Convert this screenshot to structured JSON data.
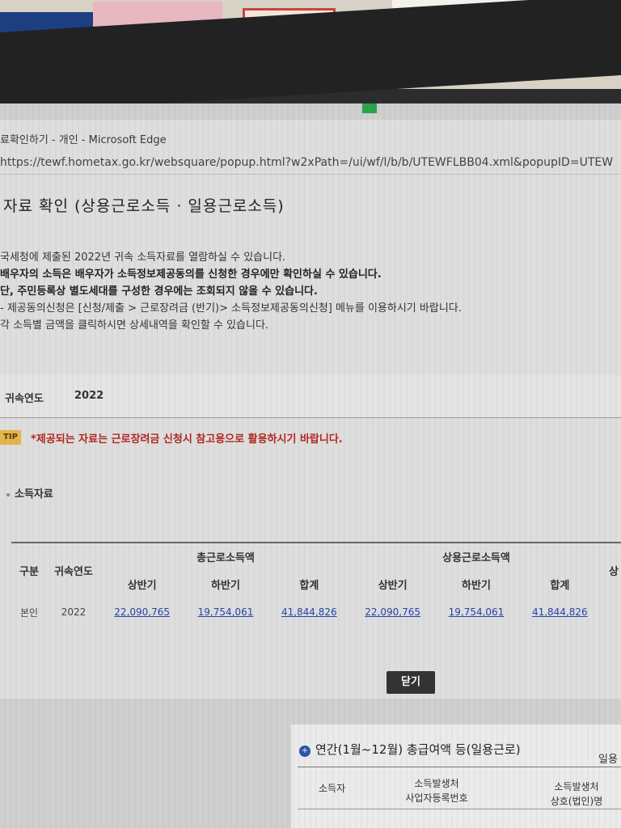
{
  "browser": {
    "window_title": "료확인하기 - 개인 - Microsoft Edge",
    "url": "https://tewf.hometax.go.kr/websquare/popup.html?w2xPath=/ui/wf/l/b/b/UTEWFLBB04.xml&popupID=UTEW"
  },
  "page": {
    "title": "자료 확인 (상용근로소득 · 일용근로소득)",
    "notes": [
      "국세청에 제출된 2022년 귀속 소득자료를 열람하실 수 있습니다.",
      "배우자의 소득은 배우자가 소득정보제공동의를 신청한 경우에만 확인하실 수 있습니다.",
      "단, 주민등록상 별도세대를 구성한 경우에는 조회되지 않을 수 있습니다.",
      "- 제공동의신청은 [신청/제출 > 근로장려금 (반기)> 소득정보제공동의신청] 메뉴를 이용하시기 바랍니다.",
      "각 소득별 금액을 클릭하시면 상세내역을 확인할 수 있습니다."
    ]
  },
  "filter": {
    "year_label": "귀속연도",
    "year_value": "2022"
  },
  "tip": {
    "badge": "TIP",
    "text": "*제공되는 자료는 근로장려금 신청시 참고용으로 활용하시기 바랍니다."
  },
  "income_section": {
    "label": "소득자료",
    "headers": {
      "category": "구분",
      "year": "귀속연도",
      "total_group": "총근로소득액",
      "regular_group": "상용근로소득액",
      "first_half": "상반기",
      "second_half": "하반기",
      "sum": "합계",
      "overflow": "상"
    },
    "rows": [
      {
        "category": "본인",
        "year": "2022",
        "total_first": "22,090,765",
        "total_second": "19,754,061",
        "total_sum": "41,844,826",
        "regular_first": "22,090,765",
        "regular_second": "19,754,061",
        "regular_sum": "41,844,826"
      }
    ]
  },
  "buttons": {
    "close": "닫기"
  },
  "background_panel": {
    "title": "연간(1월~12월) 총급여액 등(일용근로)",
    "extra": "일용",
    "col_worker": "소득자",
    "col_biz_no_line1": "소득발생처",
    "col_biz_no_line2": "사업자등록번호",
    "col_biz_name_line1": "소득발생처",
    "col_biz_name_line2": "상호(법인)명"
  },
  "colors": {
    "link": "#2646a8",
    "tip_text": "#b3261e",
    "tip_badge": "#e4b54a"
  }
}
